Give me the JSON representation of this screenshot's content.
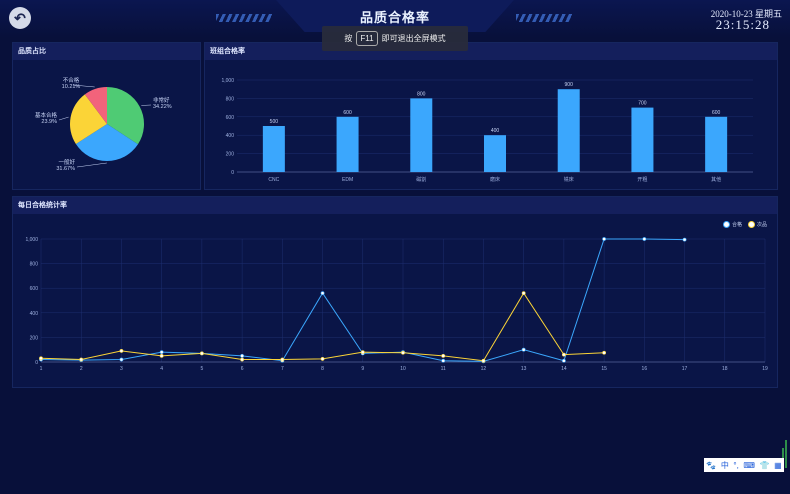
{
  "header": {
    "title": "品质合格率",
    "date": "2020-10-23 星期五",
    "time": "23:15:28"
  },
  "toast": {
    "pre": "按",
    "key": "F11",
    "post": "即可退出全屏模式"
  },
  "panels": {
    "pie_title": "品质占比",
    "bar_title": "班组合格率",
    "line_title": "每日合格统计率"
  },
  "ime": {
    "label": "中"
  },
  "chart_data": [
    {
      "type": "pie",
      "slices": [
        {
          "label": "非常好",
          "percent": "34.22%",
          "value": 34.22,
          "color": "#4fcb74"
        },
        {
          "label": "一般好",
          "percent": "31.67%",
          "value": 31.67,
          "color": "#3ba7fd"
        },
        {
          "label": "基本合格",
          "percent": "23.9%",
          "value": 23.9,
          "color": "#fbd437"
        },
        {
          "label": "不合格",
          "percent": "10.21%",
          "value": 10.21,
          "color": "#f2637b"
        }
      ]
    },
    {
      "type": "bar",
      "categories": [
        "CNC",
        "EDM",
        "磁割",
        "磨床",
        "铣床",
        "开粗",
        "其他"
      ],
      "values": [
        500,
        600,
        800,
        400,
        900,
        700,
        600
      ],
      "ylim": [
        0,
        1000
      ],
      "yticks": [
        "0",
        "200",
        "400",
        "600",
        "800",
        "1,000"
      ],
      "color": "#3ba7fd"
    },
    {
      "type": "line",
      "x": [
        "1",
        "2",
        "3",
        "4",
        "5",
        "6",
        "7",
        "8",
        "9",
        "10",
        "11",
        "12",
        "13",
        "14",
        "15",
        "16",
        "17",
        "18",
        "19"
      ],
      "ylim": [
        0,
        1000
      ],
      "yticks": [
        "0",
        "200",
        "400",
        "600",
        "800",
        "1,000"
      ],
      "series": [
        {
          "name": "合格",
          "color": "#3ba7fd",
          "values": [
            20,
            15,
            20,
            80,
            70,
            50,
            10,
            560,
            70,
            80,
            10,
            5,
            100,
            10,
            1000,
            1000,
            995,
            null,
            null
          ]
        },
        {
          "name": "次品",
          "color": "#fbd437",
          "values": [
            30,
            20,
            90,
            50,
            70,
            20,
            20,
            25,
            80,
            75,
            50,
            10,
            560,
            60,
            75,
            null,
            null,
            null,
            null
          ]
        }
      ]
    }
  ]
}
